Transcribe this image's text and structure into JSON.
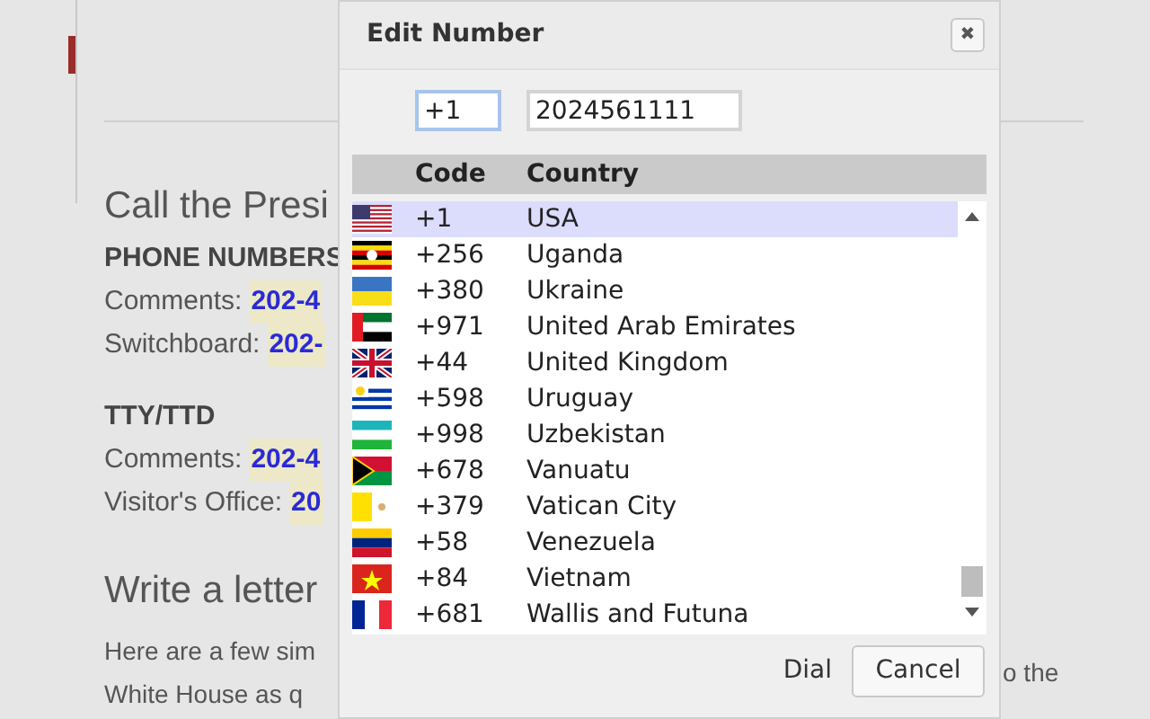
{
  "page": {
    "heading": "Call the Presi",
    "sections": [
      {
        "title": "PHONE NUMBERS",
        "lines": [
          {
            "label": "Comments:",
            "number": "202-4"
          },
          {
            "label": "Switchboard:",
            "number": "202-"
          }
        ]
      },
      {
        "title": "TTY/TTD",
        "lines": [
          {
            "label": "Comments:",
            "number": "202-4"
          },
          {
            "label": "Visitor's Office:",
            "number": "20"
          }
        ]
      }
    ],
    "heading_2": "Write a letter",
    "paragraph_lines": [
      "Here are a few sim",
      "White House as q"
    ],
    "paragraph_right": "o the"
  },
  "dialog": {
    "title": "Edit Number",
    "close": "✖",
    "code_field": {
      "value": "+1"
    },
    "number_field": {
      "value": "2024561111"
    },
    "columns": [
      "Code",
      "Country"
    ],
    "rows": [
      {
        "kind": "usa",
        "code": "+1",
        "country": "USA",
        "selected": true
      },
      {
        "kind": "uganda",
        "code": "+256",
        "country": "Uganda",
        "selected": false
      },
      {
        "kind": "ukraine",
        "code": "+380",
        "country": "Ukraine",
        "selected": false
      },
      {
        "kind": "uae",
        "code": "+971",
        "country": "United Arab Emirates",
        "selected": false
      },
      {
        "kind": "uk",
        "code": "+44",
        "country": "United Kingdom",
        "selected": false
      },
      {
        "kind": "uruguay",
        "code": "+598",
        "country": "Uruguay",
        "selected": false
      },
      {
        "kind": "uzbekistan",
        "code": "+998",
        "country": "Uzbekistan",
        "selected": false
      },
      {
        "kind": "vanuatu",
        "code": "+678",
        "country": "Vanuatu",
        "selected": false
      },
      {
        "kind": "vatican",
        "code": "+379",
        "country": "Vatican City",
        "selected": false
      },
      {
        "kind": "venezuela",
        "code": "+58",
        "country": "Venezuela",
        "selected": false
      },
      {
        "kind": "vietnam",
        "code": "+84",
        "country": "Vietnam",
        "selected": false
      },
      {
        "kind": "wallis",
        "code": "+681",
        "country": "Wallis and Futuna",
        "selected": false
      }
    ],
    "buttons": {
      "dial": "Dial",
      "cancel": "Cancel"
    }
  }
}
